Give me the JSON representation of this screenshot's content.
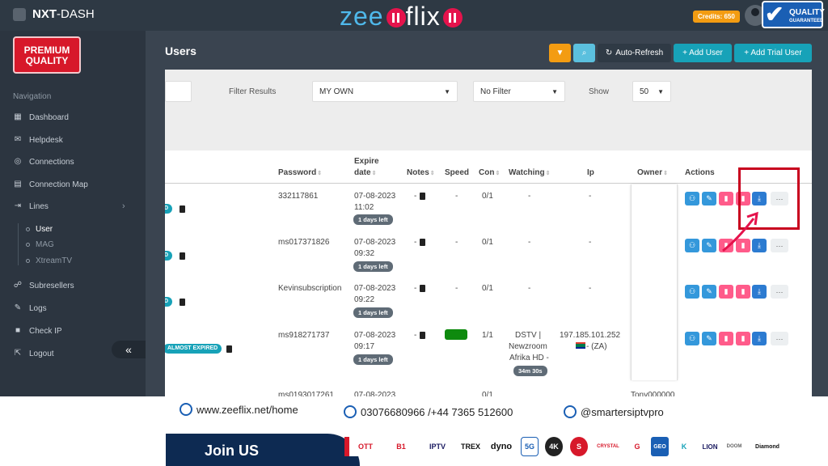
{
  "header": {
    "app_name_bold": "NXT",
    "app_name_rest": "-DASH",
    "brand_part1": "zee",
    "brand_part2": "flix",
    "credits": "Credits: 650",
    "quality_badge_line1": "QUALITY",
    "quality_badge_line2": "GUARANTEED"
  },
  "sidebar": {
    "premium_badge": "PREMIUM QUALITY",
    "heading": "Navigation",
    "items": [
      {
        "label": "Dashboard",
        "icon": "dashboard-icon"
      },
      {
        "label": "Helpdesk",
        "icon": "chat-icon"
      },
      {
        "label": "Connections",
        "icon": "connections-icon"
      },
      {
        "label": "Connection Map",
        "icon": "map-icon"
      },
      {
        "label": "Lines",
        "icon": "lines-icon"
      },
      {
        "label": "Subresellers",
        "icon": "users-icon"
      },
      {
        "label": "Logs",
        "icon": "logs-icon"
      },
      {
        "label": "Check IP",
        "icon": "camera-icon"
      },
      {
        "label": "Logout",
        "icon": "logout-icon"
      }
    ],
    "sub_items": [
      "User",
      "MAG",
      "XtreamTV"
    ],
    "collapse": "«"
  },
  "page": {
    "title": "Users",
    "buttons": {
      "auto_refresh": "Auto-Refresh",
      "add_user": "+ Add User",
      "add_trial_user": "+ Add Trial User"
    }
  },
  "filters": {
    "filter_results_label": "Filter Results",
    "owner_select": "MY OWN",
    "status_select": "No Filter",
    "show_label": "Show",
    "show_count": "50"
  },
  "table": {
    "headers": {
      "password": "Password",
      "expire_date_1": "Expire",
      "expire_date_2": "date",
      "notes": "Notes",
      "speed": "Speed",
      "con": "Con",
      "watching": "Watching",
      "ip": "Ip",
      "owner": "Owner",
      "actions": "Actions"
    },
    "rows": [
      {
        "status": "D",
        "password": "332117861",
        "date": "07-08-2023",
        "time": "11:02",
        "days_left": "1 days left",
        "notes": "-",
        "speed": "-",
        "con": "0/1",
        "watching": "-",
        "ip": "-"
      },
      {
        "status": "D",
        "password": "ms017371826",
        "date": "07-08-2023",
        "time": "09:32",
        "days_left": "1 days left",
        "notes": "-",
        "speed": "-",
        "con": "0/1",
        "watching": "-",
        "ip": "-"
      },
      {
        "status": "D",
        "password": "Kevinsubscription",
        "date": "07-08-2023",
        "time": "09:22",
        "days_left": "1 days left",
        "notes": "-",
        "speed": "-",
        "con": "0/1",
        "watching": "-",
        "ip": "-"
      },
      {
        "status": "ALMOST EXPIRED",
        "password": "ms918271737",
        "date": "07-08-2023",
        "time": "09:17",
        "days_left": "1 days left",
        "notes": "-",
        "speed": "",
        "con": "1/1",
        "watching_1": "DSTV |",
        "watching_2": "Newzroom",
        "watching_3": "Afrika HD -",
        "watching_time": "34m 30s",
        "ip": "197.185.101.252",
        "ip_country": "- (ZA)"
      }
    ],
    "partial_row": {
      "password": "ms0193017261",
      "date": "07-08-2023",
      "con": "0/1",
      "owner": "Tony000000"
    },
    "more_label": "···"
  },
  "footer": {
    "website": "www.zeeflix.net/home",
    "phone": "03076680966 /+44 7365 512600",
    "social": "@smartersiptvpro",
    "join": "Join US",
    "partners": [
      "OTT",
      "B1",
      "IPTV",
      "TREX",
      "dyno",
      "5G",
      "4K",
      "S",
      "CRYSTAL",
      "G",
      "GEO",
      "K",
      "LION",
      "DOOM",
      "Diamond"
    ]
  },
  "colors": {
    "accent_teal": "#17a2b8",
    "accent_orange": "#f39c12",
    "action_blue": "#3498db",
    "action_pink": "#ff5b8a",
    "highlight_red": "#c8001e"
  }
}
